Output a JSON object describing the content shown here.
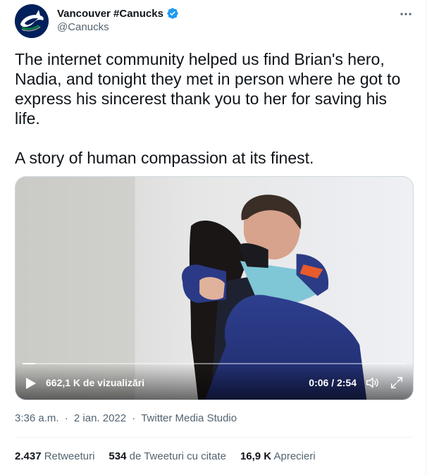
{
  "author": {
    "display_name": "Vancouver #Canucks",
    "handle": "@Canucks",
    "verified": true,
    "avatar_icon": "canucks-orca-logo"
  },
  "tweet": {
    "text": "The internet community helped us find Brian's hero, Nadia, and tonight they met in person where he got to express his sincerest thank you to her for saving his life.\n\nA story of human compassion at its finest."
  },
  "video": {
    "views": "662,1 K de vizualizări",
    "timecode": "0:06 / 2:54",
    "progress": 0.034
  },
  "meta": {
    "time": "3:36 a.m.",
    "separator": "·",
    "date": "2 ian. 2022",
    "source": "Twitter Media Studio"
  },
  "stats": {
    "retweets_count": "2.437",
    "retweets_label": "Retweeturi",
    "quotes_count": "534",
    "quotes_label": "de Tweeturi cu citate",
    "likes_count": "16,9 K",
    "likes_label": "Aprecieri"
  },
  "colors": {
    "verified": "#1d9bf0",
    "secondary_text": "#536471",
    "avatar_bg": "#00205b"
  }
}
